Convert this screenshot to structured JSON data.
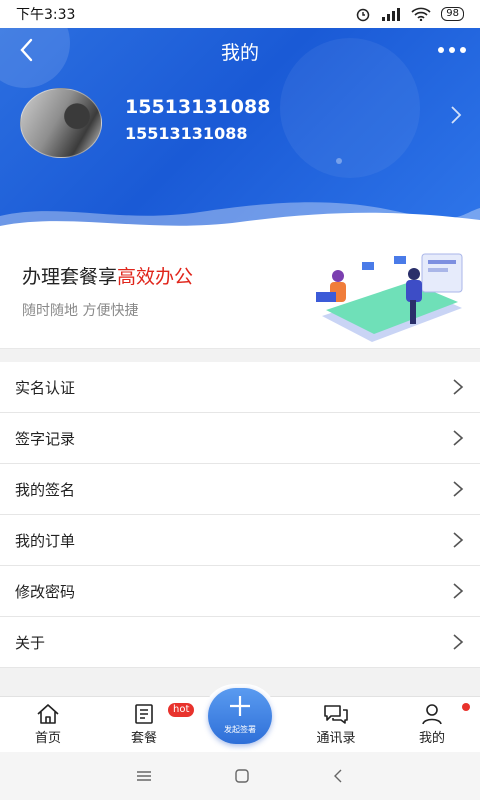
{
  "status_bar": {
    "time": "下午3:33",
    "battery": "98"
  },
  "header": {
    "title": "我的",
    "phone_primary": "15513131088",
    "phone_secondary": "15513131088",
    "colors": {
      "gradient_start": "#2c6fe0",
      "gradient_end": "#2f76ea"
    }
  },
  "promo": {
    "title_prefix": "办理套餐享",
    "title_highlight": "高效办公",
    "subtitle": "随时随地  方便快捷",
    "highlight_color": "#e0251b"
  },
  "menu": {
    "items": [
      {
        "label": "实名认证"
      },
      {
        "label": "签字记录"
      },
      {
        "label": "我的签名"
      },
      {
        "label": "我的订单"
      },
      {
        "label": "修改密码"
      },
      {
        "label": "关于"
      }
    ]
  },
  "tabbar": {
    "home": "首页",
    "package": "套餐",
    "hot_badge": "hot",
    "fab_label": "发起签署",
    "contacts": "通讯录",
    "mine": "我的"
  },
  "icons": [
    "back-arrow-icon",
    "more-dots-icon",
    "chevron-right-icon",
    "home-icon",
    "document-icon",
    "plus-icon",
    "chat-icon",
    "user-icon"
  ]
}
